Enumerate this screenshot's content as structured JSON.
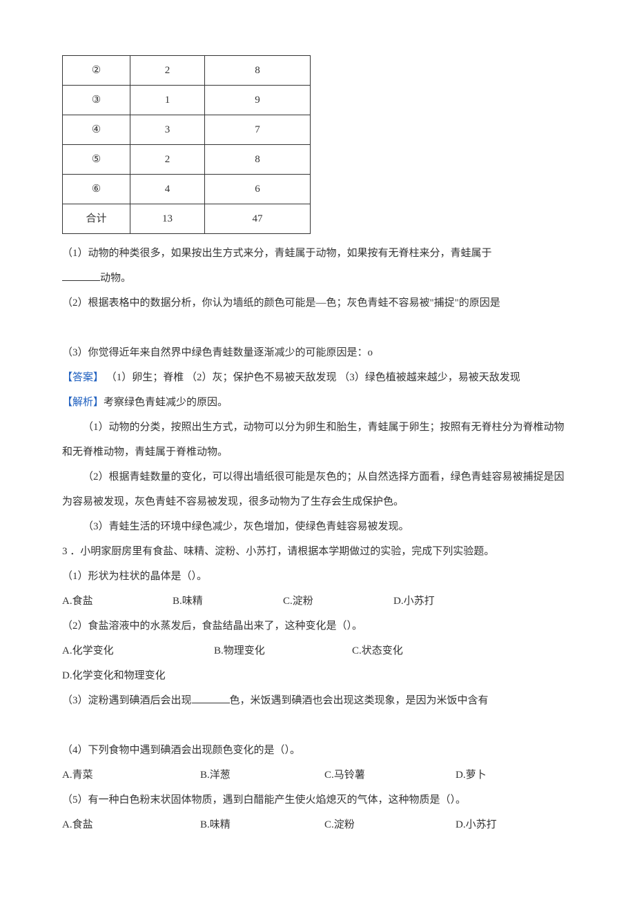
{
  "table": {
    "rows": [
      {
        "label": "②",
        "v1": "2",
        "v2": "8"
      },
      {
        "label": "③",
        "v1": "1",
        "v2": "9"
      },
      {
        "label": "④",
        "v1": "3",
        "v2": "7"
      },
      {
        "label": "⑤",
        "v1": "2",
        "v2": "8"
      },
      {
        "label": "⑥",
        "v1": "4",
        "v2": "6"
      },
      {
        "label": "合计",
        "v1": "13",
        "v2": "47"
      }
    ]
  },
  "q1": {
    "p1_a": "（1）动物的种类很多，如果按出生方式来分，青蛙属于动物，如果按有无脊柱来分，青蛙属于",
    "p1_b": "动物。",
    "p2": "（2）根据表格中的数据分析，你认为墙纸的颜色可能是—色；灰色青蛙不容易被\"捕捉\"的原因是",
    "p3": "（3）你觉得近年来自然界中绿色青蛙数量逐渐减少的可能原因是：o",
    "ans_label": "【答案】",
    "ans_text": " （1）卵生；脊椎 （2）灰；保护色不易被天敌发现 （3）绿色植被越来越少，易被天敌发现",
    "ana_label": "【解析】",
    "ana_intro": "考察绿色青蛙减少的原因。",
    "ana1": "（1）动物的分类，按照出生方式，动物可以分为卵生和胎生，青蛙属于卵生；按照有无脊柱分为脊椎动物和无脊椎动物，青蛙属于脊椎动物。",
    "ana2": "（2）根据青蛙数量的变化，可以得出墙纸很可能是灰色的；从自然选择方面看，绿色青蛙容易被捕捉是因为容易被发现，灰色青蛙不容易被发现，很多动物为了生存会生成保护色。",
    "ana3": "（3）青蛙生活的环境中绿色减少，灰色增加，使绿色青蛙容易被发现。"
  },
  "q2": {
    "stem": "3 ．小明家厨房里有食盐、味精、淀粉、小苏打，请根据本学期做过的实验，完成下列实验题。",
    "s1": "（1）形状为柱状的晶体是（）。",
    "s1o": {
      "a": "A.食盐",
      "b": "B.味精",
      "c": "C.淀粉",
      "d": "D.小苏打"
    },
    "s2": "（2）食盐溶液中的水蒸发后，食盐结晶出来了，这种变化是（）。",
    "s2o": {
      "a": "A.化学变化",
      "b": "B.物理变化",
      "c": "C.状态变化",
      "d": "D.化学变化和物理变化"
    },
    "s3_a": "（3）淀粉遇到碘酒后会出现",
    "s3_b": "色，米饭遇到碘酒也会出现这类现象，是因为米饭中含有",
    "s4": "（4）下列食物中遇到碘酒会出现颜色变化的是（）。",
    "s4o": {
      "a": "A.青菜",
      "b": "B.洋葱",
      "c": "C.马铃薯",
      "d": "D.萝卜"
    },
    "s5": "（5）有一种白色粉末状固体物质，遇到白醋能产生使火焰熄灭的气体，这种物质是（）。",
    "s5o": {
      "a": "A.食盐",
      "b": "B.味精",
      "c": "C.淀粉",
      "d": "D.小苏打"
    }
  }
}
